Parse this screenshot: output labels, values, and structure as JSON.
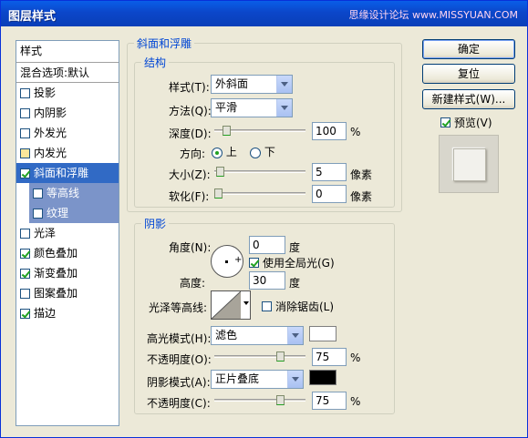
{
  "window": {
    "title": "图层样式",
    "watermark": "思缘设计论坛 www.MISSYUAN.COM"
  },
  "styles_panel": {
    "header": "样式",
    "blend_options": "混合选项:默认",
    "items": [
      {
        "label": "投影",
        "checked": false
      },
      {
        "label": "内阴影",
        "checked": false
      },
      {
        "label": "外发光",
        "checked": false
      },
      {
        "label": "内发光",
        "checked": false
      },
      {
        "label": "斜面和浮雕",
        "checked": true,
        "selected": true
      },
      {
        "label": "等高线",
        "checked": false,
        "sub": true
      },
      {
        "label": "纹理",
        "checked": false,
        "sub": true
      },
      {
        "label": "光泽",
        "checked": false
      },
      {
        "label": "颜色叠加",
        "checked": true
      },
      {
        "label": "渐变叠加",
        "checked": true
      },
      {
        "label": "图案叠加",
        "checked": false
      },
      {
        "label": "描边",
        "checked": true
      }
    ]
  },
  "bevel": {
    "section_title": "斜面和浮雕",
    "structure_title": "结构",
    "style_label": "样式(T):",
    "style_value": "外斜面",
    "technique_label": "方法(Q):",
    "technique_value": "平滑",
    "depth_label": "深度(D):",
    "depth_value": "100",
    "depth_unit": "%",
    "depth_level": 0.1,
    "direction_label": "方向:",
    "direction_up": "上",
    "direction_down": "下",
    "size_label": "大小(Z):",
    "size_value": "5",
    "size_unit": "像素",
    "size_level": 0.02,
    "soften_label": "软化(F):",
    "soften_value": "0",
    "soften_unit": "像素",
    "soften_level": 0
  },
  "shading": {
    "title": "阴影",
    "angle_label": "角度(N):",
    "angle_value": "0",
    "angle_unit": "度",
    "global_light_label": "使用全局光(G)",
    "global_light_checked": true,
    "altitude_label": "高度:",
    "altitude_value": "30",
    "altitude_unit": "度",
    "gloss_contour_label": "光泽等高线:",
    "antialias_label": "消除锯齿(L)",
    "antialias_checked": false,
    "highlight_mode_label": "高光模式(H):",
    "highlight_mode_value": "滤色",
    "highlight_color": "#ffffff",
    "highlight_opacity_label": "不透明度(O):",
    "highlight_opacity_value": "75",
    "highlight_opacity_unit": "%",
    "highlight_opacity_level": 0.75,
    "shadow_mode_label": "阴影模式(A):",
    "shadow_mode_value": "正片叠底",
    "shadow_color": "#000000",
    "shadow_opacity_label": "不透明度(C):",
    "shadow_opacity_value": "75",
    "shadow_opacity_unit": "%",
    "shadow_opacity_level": 0.75
  },
  "buttons": {
    "ok": "确定",
    "reset": "复位",
    "new_style": "新建样式(W)...",
    "preview_label": "预览(V)",
    "preview_checked": true
  }
}
